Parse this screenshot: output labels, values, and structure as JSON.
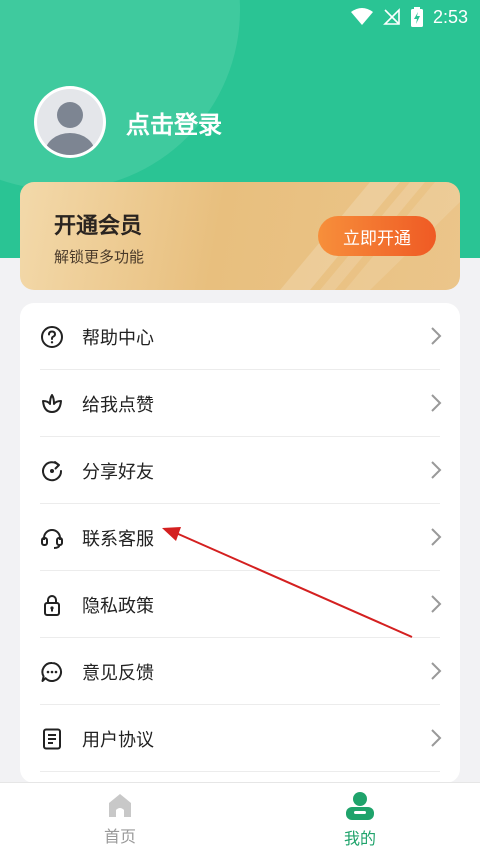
{
  "status_bar": {
    "time": "2:53"
  },
  "profile": {
    "login_label": "点击登录"
  },
  "vip": {
    "title": "开通会员",
    "subtitle": "解锁更多功能",
    "button_label": "立即开通"
  },
  "menu": {
    "items": [
      {
        "label": "帮助中心",
        "icon": "help-circle-icon"
      },
      {
        "label": "给我点赞",
        "icon": "flower-icon"
      },
      {
        "label": "分享好友",
        "icon": "share-refresh-icon"
      },
      {
        "label": "联系客服",
        "icon": "headset-icon"
      },
      {
        "label": "隐私政策",
        "icon": "lock-icon"
      },
      {
        "label": "意见反馈",
        "icon": "chat-bubble-icon"
      },
      {
        "label": "用户协议",
        "icon": "document-icon"
      }
    ]
  },
  "bottom_nav": {
    "tabs": [
      {
        "label": "首页",
        "icon": "home-icon",
        "active": false
      },
      {
        "label": "我的",
        "icon": "profile-icon",
        "active": true
      }
    ]
  },
  "colors": {
    "brand_green": "#2ac494",
    "vip_orange": "#f07030",
    "annotation_red": "#d42020"
  }
}
